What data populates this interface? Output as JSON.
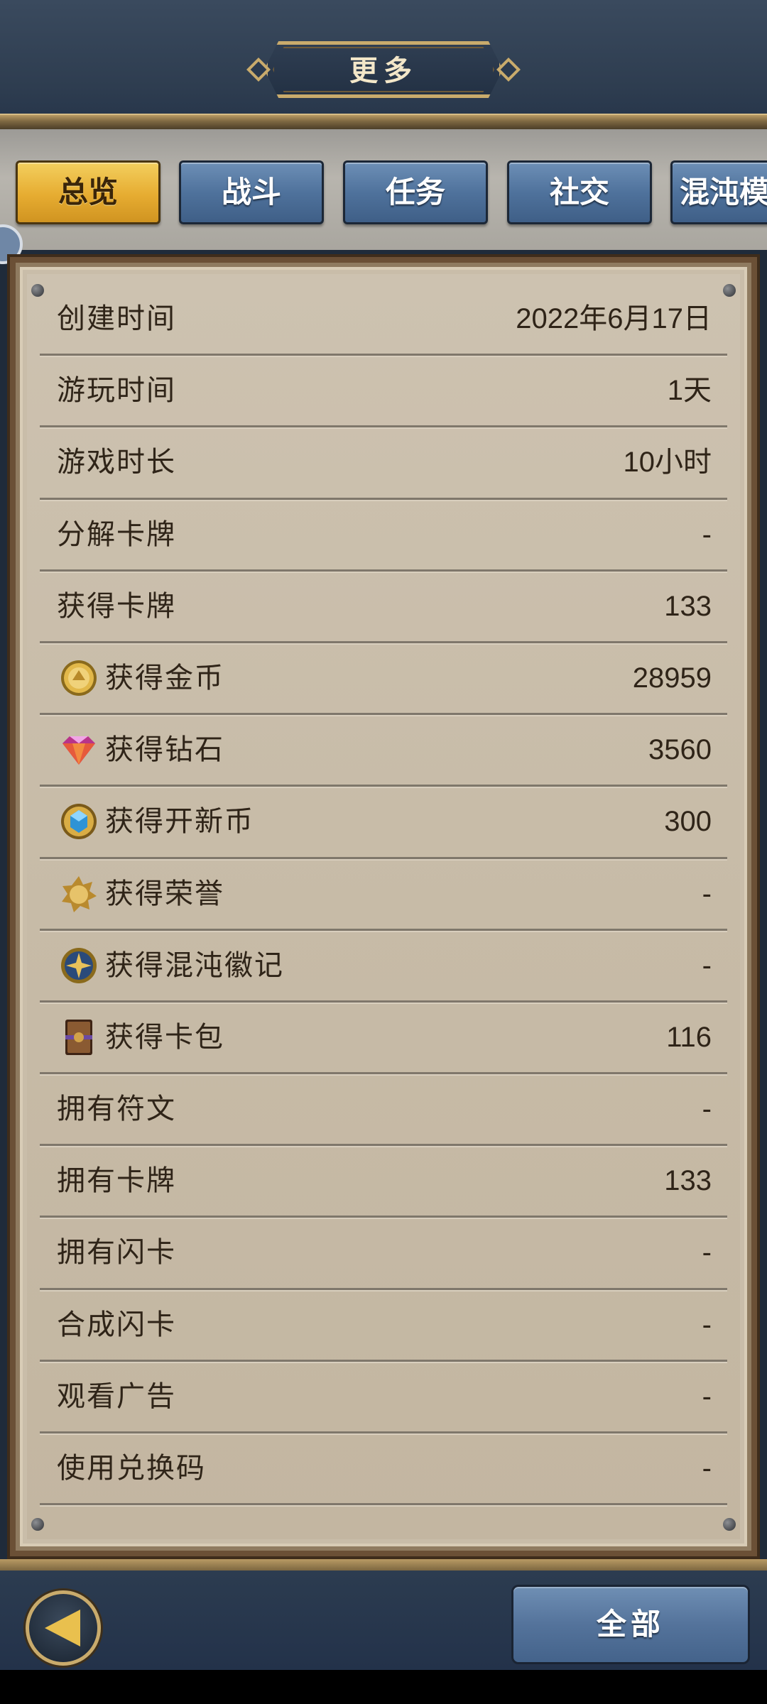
{
  "header": {
    "title": "更多"
  },
  "tabs": [
    {
      "label": "总览",
      "active": true
    },
    {
      "label": "战斗",
      "active": false
    },
    {
      "label": "任务",
      "active": false
    },
    {
      "label": "社交",
      "active": false
    },
    {
      "label": "混沌模",
      "active": false
    }
  ],
  "stats": [
    {
      "label": "创建时间",
      "value": "2022年6月17日",
      "icon": null
    },
    {
      "label": "游玩时间",
      "value": "1天",
      "icon": null
    },
    {
      "label": "游戏时长",
      "value": "10小时",
      "icon": null
    },
    {
      "label": "分解卡牌",
      "value": "-",
      "icon": null
    },
    {
      "label": "获得卡牌",
      "value": "133",
      "icon": null
    },
    {
      "label": "获得金币",
      "value": "28959",
      "icon": "gold-coin-icon"
    },
    {
      "label": "获得钻石",
      "value": "3560",
      "icon": "diamond-icon"
    },
    {
      "label": "获得开新币",
      "value": "300",
      "icon": "crystal-coin-icon"
    },
    {
      "label": "获得荣誉",
      "value": "-",
      "icon": "honor-badge-icon"
    },
    {
      "label": "获得混沌徽记",
      "value": "-",
      "icon": "chaos-emblem-icon"
    },
    {
      "label": "获得卡包",
      "value": "116",
      "icon": "card-pack-icon"
    },
    {
      "label": "拥有符文",
      "value": "-",
      "icon": null
    },
    {
      "label": "拥有卡牌",
      "value": "133",
      "icon": null
    },
    {
      "label": "拥有闪卡",
      "value": "-",
      "icon": null
    },
    {
      "label": "合成闪卡",
      "value": "-",
      "icon": null
    },
    {
      "label": "观看广告",
      "value": "-",
      "icon": null
    },
    {
      "label": "使用兑换码",
      "value": "-",
      "icon": null
    }
  ],
  "footer": {
    "all_label": "全部"
  },
  "colors": {
    "active_tab": "#e6ac31",
    "inactive_tab": "#54739b",
    "paper": "#c7bba7",
    "text": "#2f2418",
    "frame_gold": "#c9ab6c"
  }
}
